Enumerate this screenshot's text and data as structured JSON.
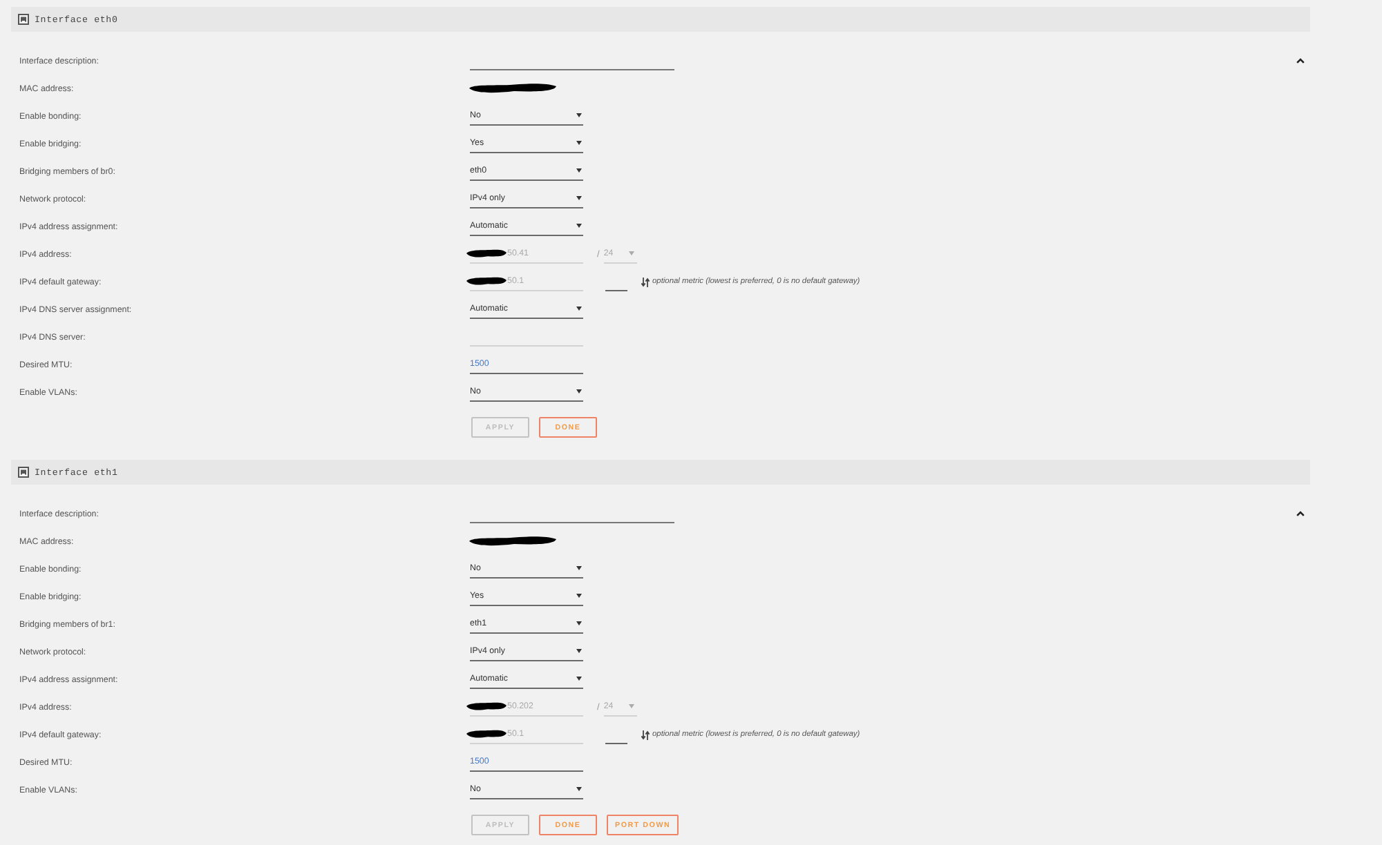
{
  "sections": [
    {
      "title": "Interface eth0",
      "expanded": true,
      "rows": [
        {
          "label": "Interface description:",
          "kind": "wide_input"
        },
        {
          "label": "MAC address:",
          "kind": "static",
          "redacted": true
        },
        {
          "label": "Enable bonding:",
          "kind": "select",
          "value": "No"
        },
        {
          "label": "Enable bridging:",
          "kind": "select",
          "value": "Yes"
        },
        {
          "label": "Bridging members of br0:",
          "kind": "select",
          "value": "eth0"
        },
        {
          "label": "Network protocol:",
          "kind": "select",
          "value": "IPv4 only"
        },
        {
          "label": "IPv4 address assignment:",
          "kind": "select",
          "value": "Automatic"
        },
        {
          "label": "IPv4 address:",
          "kind": "address",
          "value": "50.41",
          "redacted": true,
          "disabled": true,
          "separator": "/",
          "prefix": "24"
        },
        {
          "label": "IPv4 default gateway:",
          "kind": "gateway",
          "value": "50.1",
          "redacted": true,
          "disabled": true,
          "hint": "optional metric (lowest is preferred, 0 is no default gateway)"
        },
        {
          "label": "IPv4 DNS server assignment:",
          "kind": "select",
          "value": "Automatic"
        },
        {
          "label": "IPv4 DNS server:",
          "kind": "input",
          "disabled": true
        },
        {
          "label": "Desired MTU:",
          "kind": "input",
          "value": "1500",
          "disabled": false
        },
        {
          "label": "Enable VLANs:",
          "kind": "select",
          "value": "No"
        }
      ],
      "buttons": [
        {
          "label": "APPLY",
          "disabled": true
        },
        {
          "label": "DONE",
          "disabled": false
        }
      ]
    },
    {
      "title": "Interface eth1",
      "expanded": true,
      "rows": [
        {
          "label": "Interface description:",
          "kind": "wide_input"
        },
        {
          "label": "MAC address:",
          "kind": "static",
          "redacted": true
        },
        {
          "label": "Enable bonding:",
          "kind": "select",
          "value": "No"
        },
        {
          "label": "Enable bridging:",
          "kind": "select",
          "value": "Yes"
        },
        {
          "label": "Bridging members of br1:",
          "kind": "select",
          "value": "eth1"
        },
        {
          "label": "Network protocol:",
          "kind": "select",
          "value": "IPv4 only"
        },
        {
          "label": "IPv4 address assignment:",
          "kind": "select",
          "value": "Automatic"
        },
        {
          "label": "IPv4 address:",
          "kind": "address",
          "value": "50.202",
          "redacted": true,
          "disabled": true,
          "separator": "/",
          "prefix": "24"
        },
        {
          "label": "IPv4 default gateway:",
          "kind": "gateway",
          "value": "50.1",
          "redacted": true,
          "disabled": true,
          "hint": "optional metric (lowest is preferred, 0 is no default gateway)"
        },
        {
          "label": "Desired MTU:",
          "kind": "input",
          "value": "1500",
          "disabled": false
        },
        {
          "label": "Enable VLANs:",
          "kind": "select",
          "value": "No"
        }
      ],
      "buttons": [
        {
          "label": "APPLY",
          "disabled": true
        },
        {
          "label": "DONE",
          "disabled": false
        },
        {
          "label": "PORT DOWN",
          "disabled": false
        }
      ]
    }
  ]
}
